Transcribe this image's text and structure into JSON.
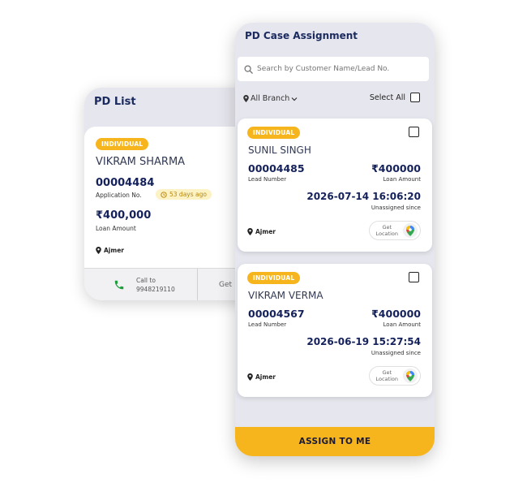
{
  "pd_list": {
    "title": "PD List",
    "card": {
      "badge": "INDIVIDUAL",
      "name": "VIKRAM SHARMA",
      "application_no": "00004484",
      "application_label": "Application No.",
      "days": "53 days ago",
      "amount": "₹400,000",
      "amount_label": "Loan Amount",
      "location": "Ajmer",
      "call_label": "Call to",
      "call_number": "9948219110",
      "get_label": "Get"
    }
  },
  "case_assignment": {
    "title": "PD Case Assignment",
    "search_placeholder": "Search by Customer Name/Lead No.",
    "branch_filter": "All Branch",
    "select_all": "Select All",
    "cases": [
      {
        "badge": "INDIVIDUAL",
        "name": "SUNIL SINGH",
        "lead_no": "00004485",
        "lead_label": "Lead Number",
        "amount": "₹400000",
        "amount_label": "Loan Amount",
        "datetime": "2026-07-14 16:06:20",
        "datetime_label": "Unassigned since",
        "location": "Ajmer",
        "get_location_1": "Get",
        "get_location_2": "Location"
      },
      {
        "badge": "INDIVIDUAL",
        "name": "VIKRAM VERMA",
        "lead_no": "00004567",
        "lead_label": "Lead Number",
        "amount": "₹400000",
        "amount_label": "Loan Amount",
        "datetime": "2026-06-19 15:27:54",
        "datetime_label": "Unassigned since",
        "location": "Ajmer",
        "get_location_1": "Get",
        "get_location_2": "Location"
      }
    ],
    "assign_button": "ASSIGN TO ME"
  },
  "colors": {
    "accent": "#f6b51c",
    "navy": "#14215a",
    "phone_bg": "#e6e6ee"
  }
}
